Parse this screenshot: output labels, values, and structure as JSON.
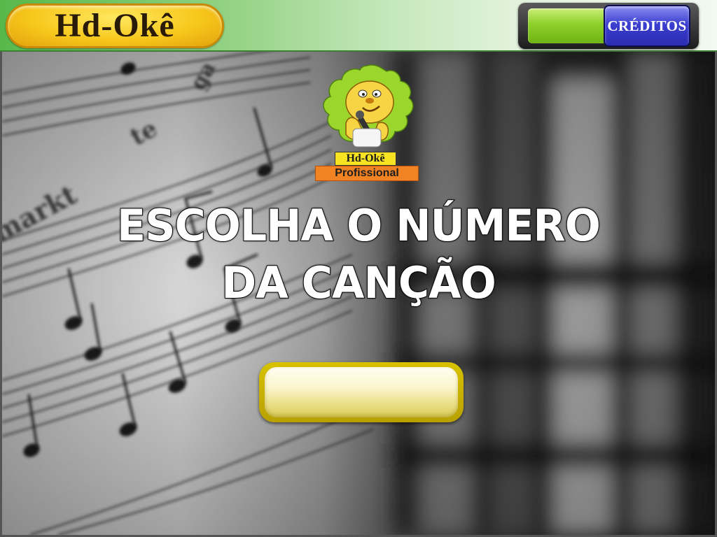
{
  "header": {
    "logo_text": "Hd-Okê",
    "credits_label": "CRÉDITOS"
  },
  "mascot": {
    "name_label": "Hd-Okê",
    "edition_label": "Profissional"
  },
  "main": {
    "heading_line1": "ESCOLHA O NÚMERO",
    "heading_line2": "DA CANÇÃO",
    "song_number_value": ""
  },
  "colors": {
    "header_green": "#58b84a",
    "logo_yellow": "#f7c81c",
    "credits_blue": "#3c3fd0",
    "input_gold": "#d6c200",
    "mascot_green": "#9bd62c",
    "tag_orange": "#f28322"
  },
  "icons": {
    "mascot": "lion-mascot-icon"
  }
}
